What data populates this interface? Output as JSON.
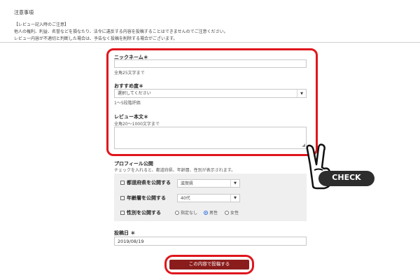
{
  "notice": {
    "title": "注意事項",
    "lines": [
      "【レビュー記入時のご注意】",
      "他人の権利、利益、名誉などを損なたり、法令に違反する内容を投稿することはできませんのでご注意ください。",
      "レビュー内容が不適切と判断した場合は、予告なく投稿を削除する場合がございます。"
    ]
  },
  "form": {
    "nickname": {
      "label": "ニックネーム＊",
      "value": "",
      "hint": "全角25文字まで"
    },
    "rating": {
      "label": "おすすめ度＊",
      "selected": "選択してください",
      "hint": "1〜5段階評価"
    },
    "review": {
      "label": "レビュー本文＊",
      "hint": "全角20〜1000文字まで",
      "value": ""
    },
    "profile": {
      "label": "プロフィール公開",
      "hint": "チェックを入れると、都道府県、年齢層、性別が表示されます。",
      "prefecture": {
        "label": "都道府県を公開する",
        "selected": "滋賀県"
      },
      "age": {
        "label": "年齢層を公開する",
        "selected": "40代"
      },
      "gender": {
        "label": "性別を公開する",
        "options": [
          "指定なし",
          "男性",
          "女性"
        ],
        "selected": "男性"
      }
    },
    "post_date": {
      "label": "投稿日 ＊",
      "value": "2019/08/19"
    },
    "submit_label": "この内容で投稿する"
  },
  "annotation": {
    "badge": "CHECK"
  },
  "colors": {
    "highlight": "#e0161d",
    "submit": "#8b1c1c",
    "badge": "#2d2d2d"
  }
}
